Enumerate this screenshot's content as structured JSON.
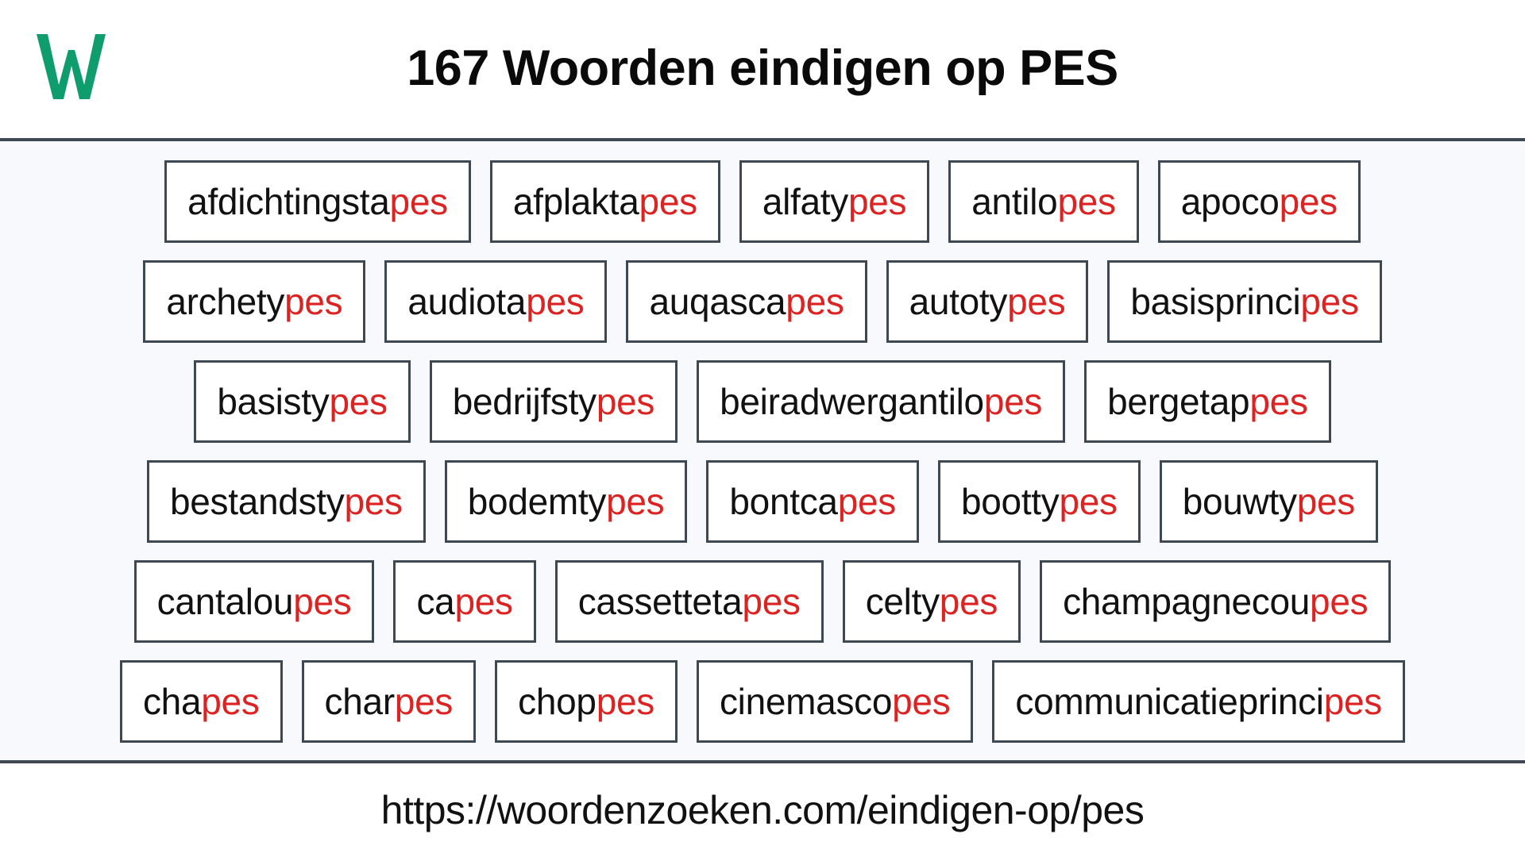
{
  "header": {
    "logo_icon": "woordenzoeken-w-logo-icon",
    "logo_letter": "W",
    "logo_color": "#0f9d6e",
    "title": "167 Woorden eindigen op PES"
  },
  "theme": {
    "page_background": "#ffffff",
    "grid_background": "#f7f9fc",
    "box_background": "#ffffff",
    "border_color": "#3d4852",
    "text_color": "#111111",
    "suffix_color": "#dd2222"
  },
  "main": {
    "suffix": "pes",
    "word_count": 167,
    "rows": [
      [
        {
          "word": "afdichtingstapes",
          "stem": "afdichtingsta",
          "suffix": "pes"
        },
        {
          "word": "afplaktapes",
          "stem": "afplakta",
          "suffix": "pes"
        },
        {
          "word": "alfatypes",
          "stem": "alfaty",
          "suffix": "pes"
        },
        {
          "word": "antilopes",
          "stem": "antilo",
          "suffix": "pes"
        },
        {
          "word": "apocopes",
          "stem": "apoco",
          "suffix": "pes"
        }
      ],
      [
        {
          "word": "archetypes",
          "stem": "archety",
          "suffix": "pes"
        },
        {
          "word": "audiotapes",
          "stem": "audiota",
          "suffix": "pes"
        },
        {
          "word": "auqascapes",
          "stem": "auqasca",
          "suffix": "pes"
        },
        {
          "word": "autotypes",
          "stem": "autoty",
          "suffix": "pes"
        },
        {
          "word": "basisprincipes",
          "stem": "basisprinci",
          "suffix": "pes"
        }
      ],
      [
        {
          "word": "basistypes",
          "stem": "basisty",
          "suffix": "pes"
        },
        {
          "word": "bedrijfstypes",
          "stem": "bedrijfsty",
          "suffix": "pes"
        },
        {
          "word": "beiradwergantilopes",
          "stem": "beiradwergantilo",
          "suffix": "pes"
        },
        {
          "word": "bergetappes",
          "stem": "bergetap",
          "suffix": "pes"
        }
      ],
      [
        {
          "word": "bestandstypes",
          "stem": "bestandsty",
          "suffix": "pes"
        },
        {
          "word": "bodemtypes",
          "stem": "bodemty",
          "suffix": "pes"
        },
        {
          "word": "bontcapes",
          "stem": "bontca",
          "suffix": "pes"
        },
        {
          "word": "boottypes",
          "stem": "bootty",
          "suffix": "pes"
        },
        {
          "word": "bouwtypes",
          "stem": "bouwty",
          "suffix": "pes"
        }
      ],
      [
        {
          "word": "cantaloupes",
          "stem": "cantalou",
          "suffix": "pes"
        },
        {
          "word": "capes",
          "stem": "ca",
          "suffix": "pes"
        },
        {
          "word": "cassettetapes",
          "stem": "cassetteta",
          "suffix": "pes"
        },
        {
          "word": "celtypes",
          "stem": "celty",
          "suffix": "pes"
        },
        {
          "word": "champagnecoupes",
          "stem": "champagnecou",
          "suffix": "pes"
        }
      ],
      [
        {
          "word": "chapes",
          "stem": "cha",
          "suffix": "pes"
        },
        {
          "word": "charpes",
          "stem": "char",
          "suffix": "pes"
        },
        {
          "word": "choppes",
          "stem": "chop",
          "suffix": "pes"
        },
        {
          "word": "cinemascopes",
          "stem": "cinemasco",
          "suffix": "pes"
        },
        {
          "word": "communicatieprincipes",
          "stem": "communicatieprinci",
          "suffix": "pes"
        }
      ]
    ]
  },
  "footer": {
    "url": "https://woordenzoeken.com/eindigen-op/pes"
  }
}
